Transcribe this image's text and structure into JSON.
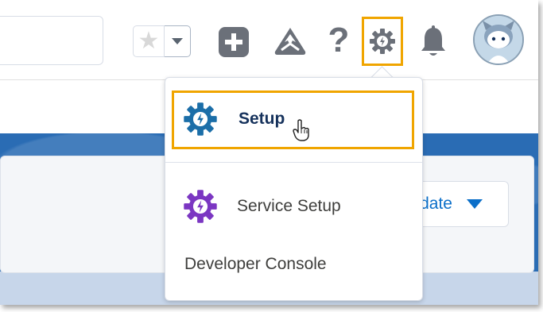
{
  "header": {
    "favorites_star": "★",
    "help_glyph": "?"
  },
  "page": {
    "update_label": "pdate"
  },
  "menu": {
    "items": [
      {
        "label": "Setup"
      },
      {
        "label": "Service Setup"
      },
      {
        "label": "Developer Console"
      }
    ]
  },
  "colors": {
    "highlight": "#f0a500",
    "setup_gear": "#1b6ea8",
    "service_gear": "#7b36c2",
    "icon_gray": "#6b7079",
    "accent_blue": "#0b6fc9"
  }
}
